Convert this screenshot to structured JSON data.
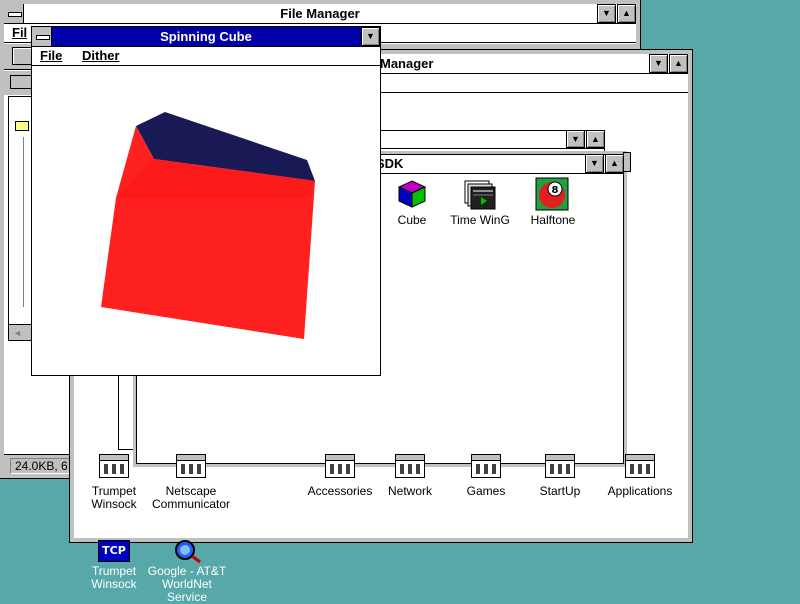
{
  "file_manager": {
    "title": "File Manager",
    "menu_partial": "Fil",
    "status_partial": "24.0KB, 6"
  },
  "program_manager": {
    "title_partial": "Manager"
  },
  "sdk_window": {
    "title_partial": "SDK",
    "icons": [
      {
        "label": "Cube",
        "icon": "cube-icon"
      },
      {
        "label": "Time WinG",
        "icon": "stack-icon"
      },
      {
        "label": "Halftone",
        "icon": "eight-ball-icon"
      }
    ]
  },
  "group_icons": [
    {
      "label_line1": "Trumpet",
      "label_line2": "Winsock"
    },
    {
      "label_line1": "Netscape",
      "label_line2": "Communicator"
    },
    {
      "label_line1": "Accessories",
      "label_line2": ""
    },
    {
      "label_line1": "Network",
      "label_line2": ""
    },
    {
      "label_line1": "Games",
      "label_line2": ""
    },
    {
      "label_line1": "StartUp",
      "label_line2": ""
    },
    {
      "label_line1": "Applications",
      "label_line2": ""
    }
  ],
  "desktop_icons": [
    {
      "label_line1": "Trumpet",
      "label_line2": "Winsock",
      "label_line3": "",
      "badge": "TCP"
    },
    {
      "label_line1": "Google - AT&T",
      "label_line2": "WorldNet",
      "label_line3": "Service",
      "badge": ""
    }
  ],
  "spinning_cube": {
    "title": "Spinning Cube",
    "menu": [
      "File",
      "Dither"
    ],
    "colors": {
      "top_face": "#191a55",
      "front_face": "#ff2020",
      "accent": "#0000a8"
    }
  },
  "controls": {
    "minimize_glyph": "▼",
    "maximize_glyph": "▲",
    "scroll_left_glyph": "◄"
  }
}
